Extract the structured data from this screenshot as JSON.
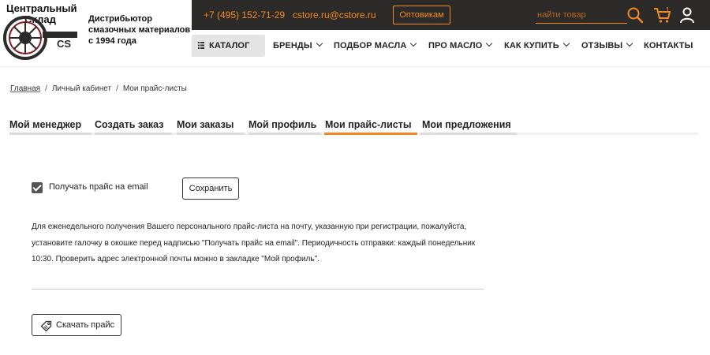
{
  "brand": {
    "name_line1": "Центральный",
    "name_line2": "Склад",
    "tagline_line1": "Дистрибьютор",
    "tagline_line2": "смазочных материалов",
    "tagline_line3": "с 1994 года",
    "logo_mark": "CS"
  },
  "topbar": {
    "phone": "+7 (495) 152-71-29",
    "email": "cstore.ru@cstore.ru",
    "wholesale_label": "Оптовикам",
    "search_placeholder": "найти товар",
    "cart_count": "1",
    "accent_color": "#f08a24",
    "bg_color": "#2d2b29",
    "icons": [
      "search-icon",
      "cart-icon",
      "user-icon"
    ]
  },
  "nav": {
    "catalog": "КАТАЛОГ",
    "brands": "БРЕНДЫ",
    "oil_selection": "ПОДБОР МАСЛА",
    "about_oil": "ПРО МАСЛО",
    "how_to_buy": "КАК КУПИТЬ",
    "reviews": "ОТЗЫВЫ",
    "contacts": "КОНТАКТЫ"
  },
  "breadcrumb": {
    "home": "Главная",
    "cabinet": "Личный кабинет",
    "current": "Мои прайс-листы"
  },
  "tabs": {
    "manager": "Мой менеджер",
    "create_order": "Создать заказ",
    "orders": "Мои заказы",
    "profile": "Мой профиль",
    "price_lists": "Мои прайс-листы",
    "offers": "Мои предложения",
    "active": "price_lists"
  },
  "price_form": {
    "checkbox_label": "Получать прайс на email",
    "checked": true,
    "save_label": "Сохранить",
    "info_text": "Для еженедельного получения Вашего персонального прайс-листа на почту, указанную при регистрации, пожалуйста, установите галочку в окошке перед надписью \"Получать прайс на email\". Периодичность отправки: каждый понедельник 10:30. Проверить адрес электронной почты можно в закладке \"Мой профиль\".",
    "download_label": "Скачать прайс"
  }
}
